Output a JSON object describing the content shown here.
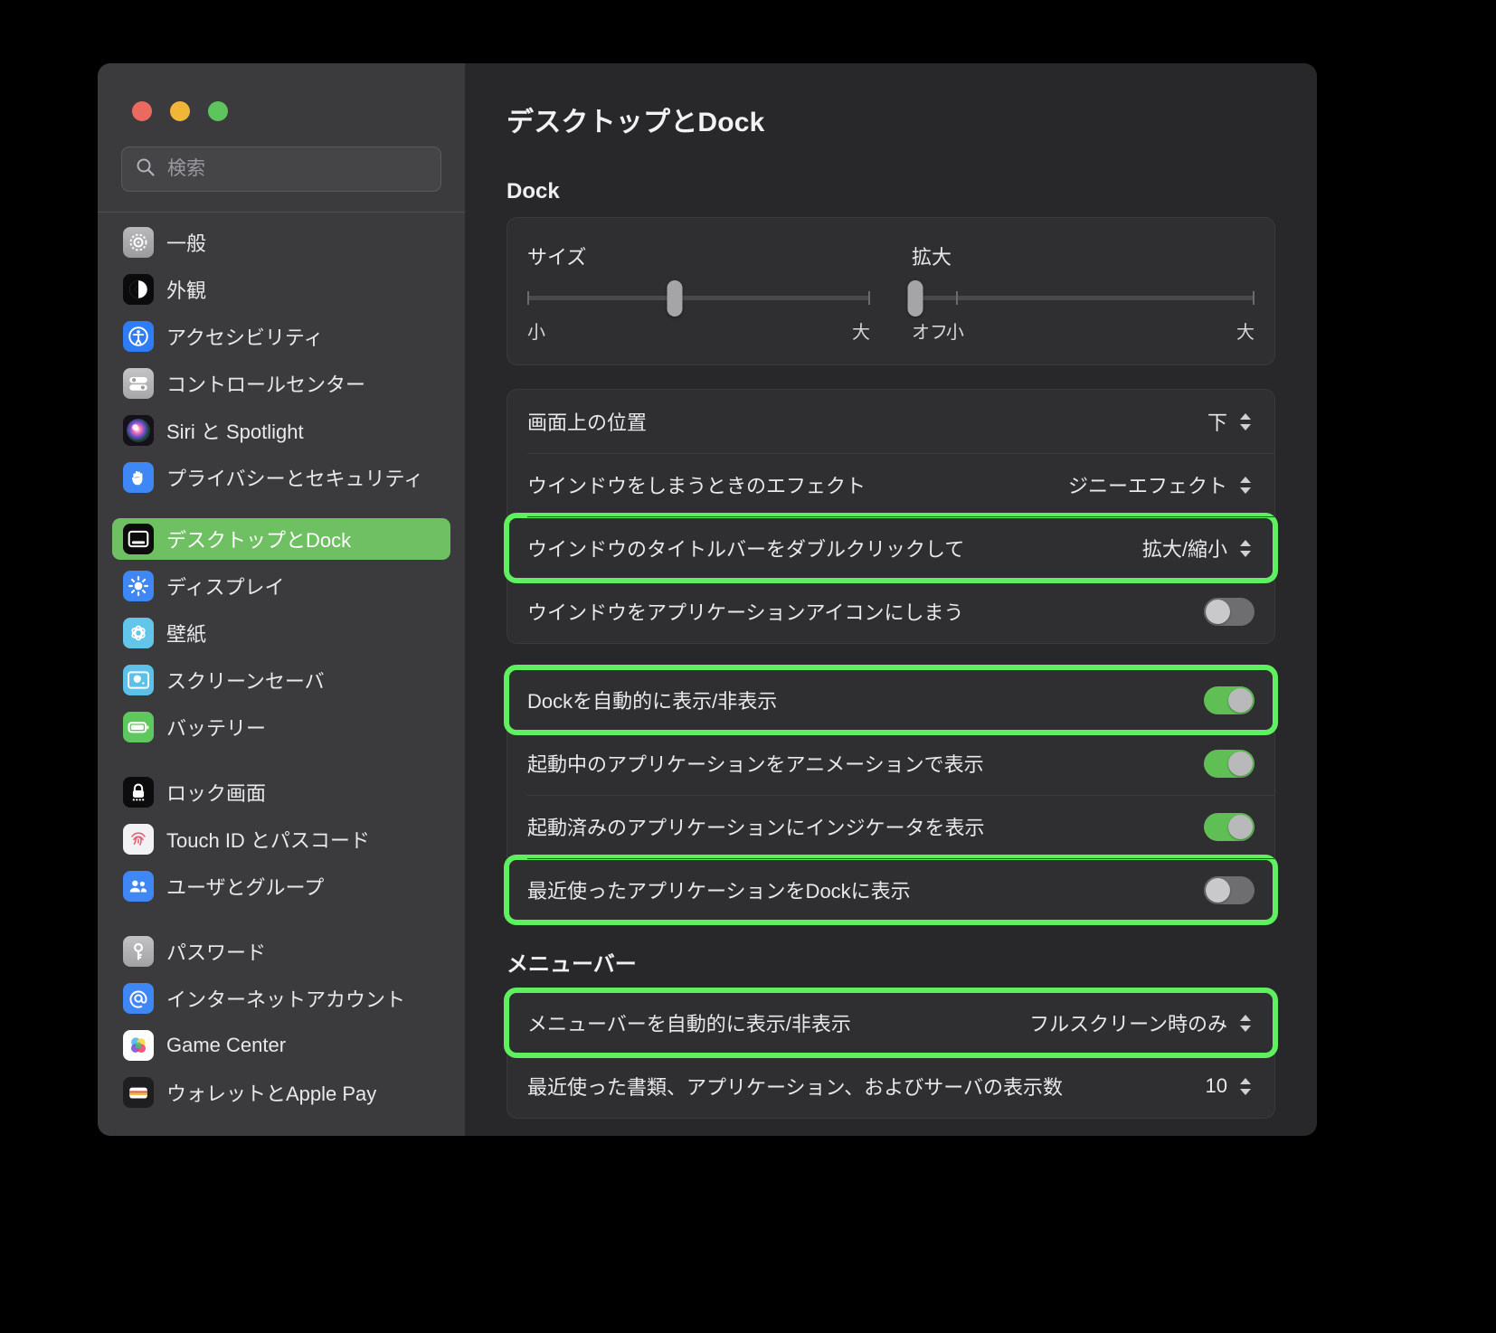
{
  "window": {
    "traffic_lights": [
      "close",
      "minimize",
      "zoom"
    ],
    "colors": {
      "close": "#ea6a60",
      "minimize": "#f0b638",
      "zoom": "#5ec45e",
      "highlight": "#5ef05e",
      "selection": "#6fbf63",
      "toggle_on": "#5fbf55"
    }
  },
  "sidebar": {
    "search": {
      "placeholder": "検索",
      "value": ""
    },
    "groups": [
      {
        "items": [
          {
            "label": "一般",
            "icon": "gear-icon",
            "selected": false
          },
          {
            "label": "外観",
            "icon": "appearance-icon",
            "selected": false
          },
          {
            "label": "アクセシビリティ",
            "icon": "accessibility-icon",
            "selected": false
          },
          {
            "label": "コントロールセンター",
            "icon": "control-center-icon",
            "selected": false
          },
          {
            "label": "Siri と Spotlight",
            "icon": "siri-icon",
            "selected": false
          },
          {
            "label": "プライバシーとセキュリティ",
            "icon": "privacy-hand-icon",
            "selected": false
          }
        ]
      },
      {
        "items": [
          {
            "label": "デスクトップとDock",
            "icon": "desktop-dock-icon",
            "selected": true
          },
          {
            "label": "ディスプレイ",
            "icon": "display-icon",
            "selected": false
          },
          {
            "label": "壁紙",
            "icon": "wallpaper-icon",
            "selected": false
          },
          {
            "label": "スクリーンセーバ",
            "icon": "screensaver-icon",
            "selected": false
          },
          {
            "label": "バッテリー",
            "icon": "battery-icon",
            "selected": false
          }
        ]
      },
      {
        "items": [
          {
            "label": "ロック画面",
            "icon": "lock-screen-icon",
            "selected": false
          },
          {
            "label": "Touch ID とパスコード",
            "icon": "touch-id-icon",
            "selected": false
          },
          {
            "label": "ユーザとグループ",
            "icon": "users-groups-icon",
            "selected": false
          }
        ]
      },
      {
        "items": [
          {
            "label": "パスワード",
            "icon": "password-key-icon",
            "selected": false
          },
          {
            "label": "インターネットアカウント",
            "icon": "internet-accounts-icon",
            "selected": false
          },
          {
            "label": "Game Center",
            "icon": "game-center-icon",
            "selected": false
          },
          {
            "label": "ウォレットとApple Pay",
            "icon": "wallet-icon",
            "selected": false
          }
        ]
      }
    ]
  },
  "main": {
    "title": "デスクトップとDock",
    "dock_section": {
      "heading": "Dock",
      "sliders": [
        {
          "label": "サイズ",
          "min_label": "小",
          "max_label": "大",
          "value_percent": 43
        },
        {
          "label": "拡大",
          "off_label": "オフ",
          "min_label": "小",
          "max_label": "大",
          "value_percent": 1
        }
      ],
      "settings_rows": [
        {
          "label": "画面上の位置",
          "value": "下",
          "control": "popup",
          "highlighted": false
        },
        {
          "label": "ウインドウをしまうときのエフェクト",
          "value": "ジニーエフェクト",
          "control": "popup",
          "highlighted": false
        },
        {
          "label": "ウインドウのタイトルバーをダブルクリックして",
          "value": "拡大/縮小",
          "control": "popup",
          "highlighted": true
        },
        {
          "label": "ウインドウをアプリケーションアイコンにしまう",
          "value": "off",
          "control": "toggle",
          "highlighted": false
        }
      ],
      "toggle_rows": [
        {
          "label": "Dockを自動的に表示/非表示",
          "value": "on",
          "control": "toggle",
          "highlighted": true
        },
        {
          "label": "起動中のアプリケーションをアニメーションで表示",
          "value": "on",
          "control": "toggle",
          "highlighted": false
        },
        {
          "label": "起動済みのアプリケーションにインジケータを表示",
          "value": "on",
          "control": "toggle",
          "highlighted": false
        },
        {
          "label": "最近使ったアプリケーションをDockに表示",
          "value": "off",
          "control": "toggle",
          "highlighted": true
        }
      ]
    },
    "menubar_section": {
      "heading": "メニューバー",
      "rows": [
        {
          "label": "メニューバーを自動的に表示/非表示",
          "value": "フルスクリーン時のみ",
          "control": "popup",
          "highlighted": true
        },
        {
          "label": "最近使った書類、アプリケーション、およびサーバの表示数",
          "value": "10",
          "control": "stepper",
          "highlighted": false
        }
      ]
    }
  }
}
